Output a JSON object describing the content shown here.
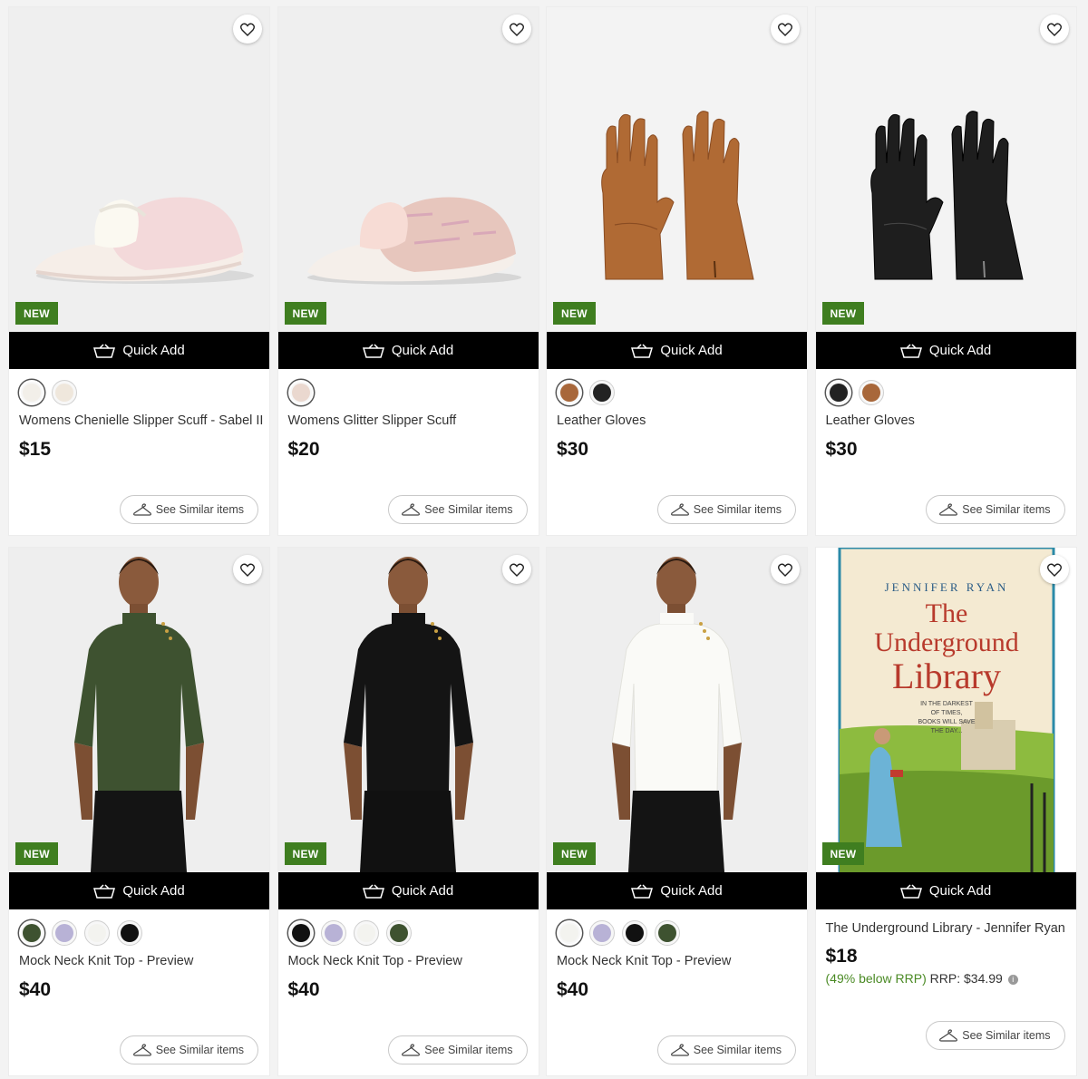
{
  "products": [
    {
      "badge": "NEW",
      "quick_add": "Quick Add",
      "title": "Womens Chenielle Slipper Scuff - Sabel II",
      "price": "$15",
      "similar": "See Similar items",
      "swatches": [
        "#f2efe9",
        "#efe7dc"
      ]
    },
    {
      "badge": "NEW",
      "quick_add": "Quick Add",
      "title": "Womens Glitter Slipper Scuff",
      "price": "$20",
      "similar": "See Similar items",
      "swatches": [
        "#ead8cf"
      ]
    },
    {
      "badge": "NEW",
      "quick_add": "Quick Add",
      "title": "Leather Gloves",
      "price": "$30",
      "similar": "See Similar items",
      "swatches": [
        "#a8673a",
        "#222222"
      ]
    },
    {
      "badge": "NEW",
      "quick_add": "Quick Add",
      "title": "Leather Gloves",
      "price": "$30",
      "similar": "See Similar items",
      "swatches": [
        "#222222",
        "#a8673a"
      ]
    },
    {
      "badge": "NEW",
      "quick_add": "Quick Add",
      "title": "Mock Neck Knit Top - Preview",
      "price": "$40",
      "similar": "See Similar items",
      "swatches": [
        "#3e5230",
        "#b8b2d6",
        "#f3f3ef",
        "#111111"
      ]
    },
    {
      "badge": "NEW",
      "quick_add": "Quick Add",
      "title": "Mock Neck Knit Top - Preview",
      "price": "$40",
      "similar": "See Similar items",
      "swatches": [
        "#111111",
        "#b8b2d6",
        "#f3f3ef",
        "#3e5230"
      ]
    },
    {
      "badge": "NEW",
      "quick_add": "Quick Add",
      "title": "Mock Neck Knit Top - Preview",
      "price": "$40",
      "similar": "See Similar items",
      "swatches": [
        "#f3f3ef",
        "#b8b2d6",
        "#111111",
        "#3e5230"
      ]
    },
    {
      "badge": "NEW",
      "quick_add": "Quick Add",
      "title": "The Underground Library - Jennifer Ryan",
      "price": "$18",
      "rrp_pct": "(49% below RRP)",
      "rrp": "RRP: $34.99",
      "similar": "See Similar items",
      "swatches": []
    }
  ],
  "book_cover": {
    "author": "JENNIFER RYAN",
    "title_line1": "The",
    "title_line2": "Underground",
    "title_line3": "Library",
    "tagline_1": "IN THE DARKEST",
    "tagline_2": "OF TIMES,",
    "tagline_3": "BOOKS WILL SAVE",
    "tagline_4": "THE DAY..."
  },
  "colors": {
    "badge": "#3f7e20",
    "quick_add_bg": "#000000",
    "rrp_green": "#4a8a24"
  }
}
